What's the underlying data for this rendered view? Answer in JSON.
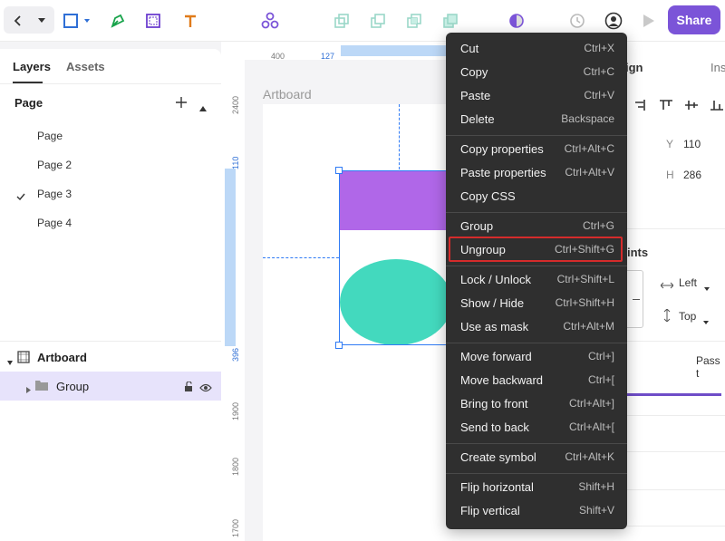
{
  "toolbar": {
    "icons": [
      "back-icon",
      "dropdown-icon",
      "rectangle-icon",
      "pen-icon",
      "frame-icon",
      "text-icon",
      "components-icon",
      "boolean-union-icon",
      "boolean-subtract-icon",
      "boolean-intersect-icon",
      "boolean-exclude-icon",
      "theme-icon",
      "history-icon",
      "user-icon",
      "play-icon"
    ],
    "share_label": "Share",
    "colors": {
      "accent": "#7b54d8",
      "rect_tool": "#2f6fd6",
      "pen_tool": "#17a34a",
      "text_tool": "#e07b1a"
    }
  },
  "left_panel": {
    "tabs": [
      {
        "label": "Layers"
      },
      {
        "label": "Assets"
      }
    ],
    "page_section_title": "Page",
    "pages": [
      {
        "label": "Page",
        "selected": false
      },
      {
        "label": "Page 2",
        "selected": false
      },
      {
        "label": "Page 3",
        "selected": true
      },
      {
        "label": "Page 4",
        "selected": false
      }
    ],
    "layers": {
      "artboard_label": "Artboard",
      "group_label": "Group"
    }
  },
  "canvas": {
    "ruler_top": {
      "left_label": "400",
      "highlight_label": "127"
    },
    "ruler_left": {
      "labels": [
        "2400",
        "110",
        "396",
        "1900",
        "1800",
        "1700"
      ]
    },
    "artboard_title": "Artboard",
    "colors": {
      "purple_rect": "#b067e8",
      "teal_ellipse": "#43d9be",
      "selection": "#2f7bf5"
    }
  },
  "right_panel": {
    "tab_partial_left": "ign",
    "tab_partial_right": "Ins",
    "y_label": "Y",
    "y_value": "110",
    "h_label": "H",
    "h_value": "286",
    "constraints_partial": "ints",
    "horizontal_constraint": "Left",
    "vertical_constraint": "Top",
    "blend_partial": "Pass t"
  },
  "context_menu": {
    "groups": [
      [
        {
          "label": "Cut",
          "shortcut": "Ctrl+X"
        },
        {
          "label": "Copy",
          "shortcut": "Ctrl+C"
        },
        {
          "label": "Paste",
          "shortcut": "Ctrl+V"
        },
        {
          "label": "Delete",
          "shortcut": "Backspace"
        }
      ],
      [
        {
          "label": "Copy properties",
          "shortcut": "Ctrl+Alt+C"
        },
        {
          "label": "Paste properties",
          "shortcut": "Ctrl+Alt+V"
        },
        {
          "label": "Copy CSS",
          "shortcut": ""
        }
      ],
      [
        {
          "label": "Group",
          "shortcut": "Ctrl+G"
        },
        {
          "label": "Ungroup",
          "shortcut": "Ctrl+Shift+G",
          "highlighted": true
        }
      ],
      [
        {
          "label": "Lock / Unlock",
          "shortcut": "Ctrl+Shift+L"
        },
        {
          "label": "Show / Hide",
          "shortcut": "Ctrl+Shift+H"
        },
        {
          "label": "Use as mask",
          "shortcut": "Ctrl+Alt+M"
        }
      ],
      [
        {
          "label": "Move forward",
          "shortcut": "Ctrl+]"
        },
        {
          "label": "Move backward",
          "shortcut": "Ctrl+["
        },
        {
          "label": "Bring to front",
          "shortcut": "Ctrl+Alt+]"
        },
        {
          "label": "Send to back",
          "shortcut": "Ctrl+Alt+["
        }
      ],
      [
        {
          "label": "Create symbol",
          "shortcut": "Ctrl+Alt+K"
        }
      ],
      [
        {
          "label": "Flip horizontal",
          "shortcut": "Shift+H"
        },
        {
          "label": "Flip vertical",
          "shortcut": "Shift+V"
        }
      ]
    ],
    "highlight_color": "#d52b2b"
  }
}
